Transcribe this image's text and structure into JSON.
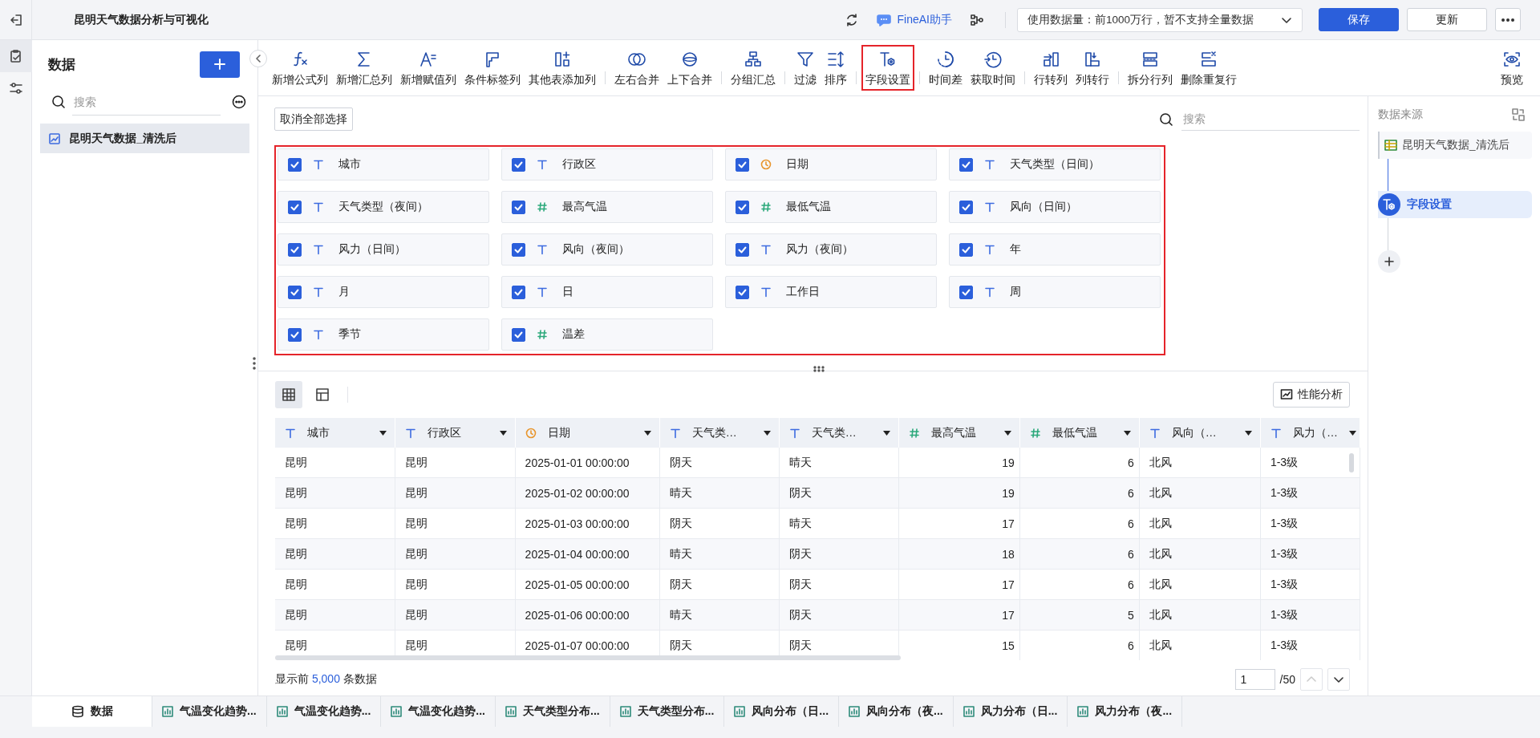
{
  "header": {
    "title": "昆明天气数据分析与可视化",
    "assistant": "FineAI助手",
    "data_usage": "使用数据量：前1000万行，暂不支持全量数据",
    "buttons": [
      {
        "label": "保存",
        "kind": "primary"
      },
      {
        "label": "更新",
        "kind": "plain"
      }
    ]
  },
  "sidebar": {
    "title": "数据",
    "search": {
      "placeholder": "搜索"
    },
    "items": [
      {
        "label": "昆明天气数据_清洗后",
        "selected": true
      }
    ]
  },
  "toolbar": {
    "groups": [
      {
        "items": [
          {
            "label": "新增公式列",
            "highlighted": false
          },
          {
            "label": "新增汇总列",
            "highlighted": false
          },
          {
            "label": "新增赋值列",
            "highlighted": false
          },
          {
            "label": "条件标签列",
            "highlighted": false
          },
          {
            "label": "其他表添加列",
            "highlighted": false
          }
        ]
      },
      {
        "items": [
          {
            "label": "左右合并",
            "highlighted": false
          },
          {
            "label": "上下合并",
            "highlighted": false
          }
        ]
      },
      {
        "items": [
          {
            "label": "分组汇总",
            "highlighted": false
          }
        ]
      },
      {
        "items": [
          {
            "label": "过滤",
            "highlighted": false
          },
          {
            "label": "排序",
            "highlighted": false
          }
        ]
      },
      {
        "items": [
          {
            "label": "字段设置",
            "highlighted": true
          }
        ]
      },
      {
        "items": [
          {
            "label": "时间差",
            "highlighted": false
          },
          {
            "label": "获取时间",
            "highlighted": false
          }
        ]
      },
      {
        "items": [
          {
            "label": "行转列",
            "highlighted": false
          },
          {
            "label": "列转行",
            "highlighted": false
          }
        ]
      },
      {
        "items": [
          {
            "label": "拆分行列",
            "highlighted": false
          },
          {
            "label": "删除重复行",
            "highlighted": false
          }
        ]
      },
      {
        "items": [
          {
            "label": "预览",
            "highlighted": false
          }
        ]
      }
    ]
  },
  "field_panel": {
    "deselect_button": "取消全部选择",
    "search": {
      "placeholder": "搜索"
    },
    "highlighted": true,
    "fields": [
      {
        "label": "城市",
        "kind": "text",
        "checked": true
      },
      {
        "label": "行政区",
        "kind": "text",
        "checked": true
      },
      {
        "label": "日期",
        "kind": "date",
        "checked": true
      },
      {
        "label": "天气类型（日间）",
        "kind": "text",
        "checked": true
      },
      {
        "label": "天气类型（夜间）",
        "kind": "text",
        "checked": true
      },
      {
        "label": "最高气温",
        "kind": "number",
        "checked": true
      },
      {
        "label": "最低气温",
        "kind": "number",
        "checked": true
      },
      {
        "label": "风向（日间）",
        "kind": "text",
        "checked": true
      },
      {
        "label": "风力（日间）",
        "kind": "text",
        "checked": true
      },
      {
        "label": "风向（夜间）",
        "kind": "text",
        "checked": true
      },
      {
        "label": "风力（夜间）",
        "kind": "text",
        "checked": true
      },
      {
        "label": "年",
        "kind": "text",
        "checked": true
      },
      {
        "label": "月",
        "kind": "text",
        "checked": true
      },
      {
        "label": "日",
        "kind": "text",
        "checked": true
      },
      {
        "label": "工作日",
        "kind": "text",
        "checked": true
      },
      {
        "label": "周",
        "kind": "text",
        "checked": true
      },
      {
        "label": "季节",
        "kind": "text",
        "checked": true
      },
      {
        "label": "温差",
        "kind": "number",
        "checked": true
      }
    ]
  },
  "table_toolbar": {
    "views": [
      {
        "kind": "grid",
        "selected": true
      },
      {
        "kind": "layout",
        "selected": false
      }
    ],
    "analysis_button": "性能分析"
  },
  "table": {
    "columns": [
      {
        "label": "城市",
        "kind": "text"
      },
      {
        "label": "行政区",
        "kind": "text"
      },
      {
        "label": "日期",
        "kind": "date"
      },
      {
        "label": "天气类…",
        "kind": "text"
      },
      {
        "label": "天气类…",
        "kind": "text"
      },
      {
        "label": "最高气温",
        "kind": "number"
      },
      {
        "label": "最低气温",
        "kind": "number"
      },
      {
        "label": "风向（…",
        "kind": "text"
      },
      {
        "label": "风力（…",
        "kind": "text"
      }
    ],
    "rows": [
      [
        "昆明",
        "昆明",
        "2025-01-01 00:00:00",
        "阴天",
        "晴天",
        "19",
        "6",
        "北风",
        "1-3级"
      ],
      [
        "昆明",
        "昆明",
        "2025-01-02 00:00:00",
        "晴天",
        "阴天",
        "19",
        "6",
        "北风",
        "1-3级"
      ],
      [
        "昆明",
        "昆明",
        "2025-01-03 00:00:00",
        "阴天",
        "晴天",
        "17",
        "6",
        "北风",
        "1-3级"
      ],
      [
        "昆明",
        "昆明",
        "2025-01-04 00:00:00",
        "晴天",
        "阴天",
        "18",
        "6",
        "北风",
        "1-3级"
      ],
      [
        "昆明",
        "昆明",
        "2025-01-05 00:00:00",
        "阴天",
        "阴天",
        "17",
        "6",
        "北风",
        "1-3级"
      ],
      [
        "昆明",
        "昆明",
        "2025-01-06 00:00:00",
        "晴天",
        "阴天",
        "17",
        "5",
        "北风",
        "1-3级"
      ],
      [
        "昆明",
        "昆明",
        "2025-01-07 00:00:00",
        "阴天",
        "阴天",
        "15",
        "6",
        "北风",
        "1-3级"
      ]
    ]
  },
  "footer": {
    "prefix": "显示前",
    "count": "5,000",
    "suffix": "条数据",
    "page": "1",
    "total_pages": "/50"
  },
  "right_panel": {
    "title": "数据来源",
    "source": "昆明天气数据_清洗后",
    "steps": [
      {
        "label": "字段设置",
        "selected": true
      }
    ]
  },
  "bottom_tabs": [
    {
      "label": "数据",
      "kind": "data",
      "selected": true
    },
    {
      "label": "气温变化趋势...",
      "kind": "chart",
      "selected": false
    },
    {
      "label": "气温变化趋势...",
      "kind": "chart",
      "selected": false
    },
    {
      "label": "气温变化趋势...",
      "kind": "chart",
      "selected": false
    },
    {
      "label": "天气类型分布...",
      "kind": "chart",
      "selected": false
    },
    {
      "label": "天气类型分布...",
      "kind": "chart",
      "selected": false
    },
    {
      "label": "风向分布（日...",
      "kind": "chart",
      "selected": false
    },
    {
      "label": "风向分布（夜...",
      "kind": "chart",
      "selected": false
    },
    {
      "label": "风力分布（日...",
      "kind": "chart",
      "selected": false
    },
    {
      "label": "风力分布（夜...",
      "kind": "chart",
      "selected": false
    }
  ]
}
